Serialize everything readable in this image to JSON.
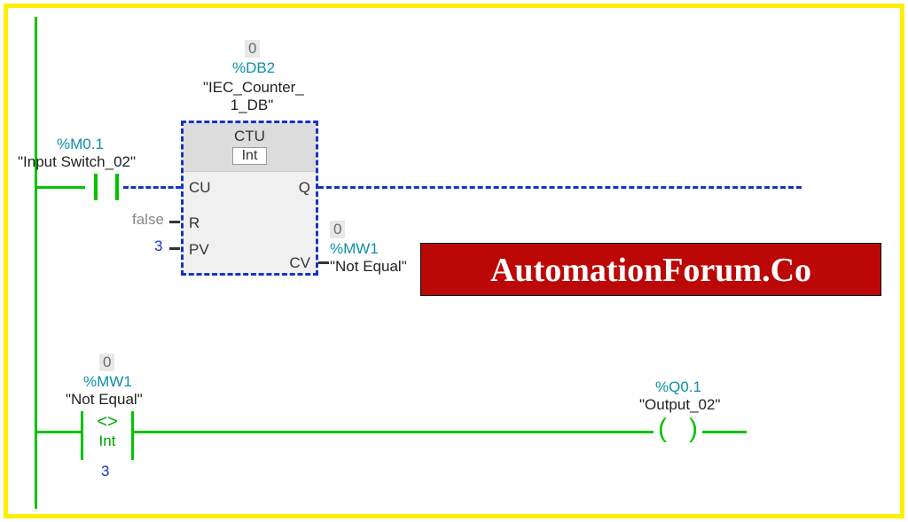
{
  "rung1": {
    "input": {
      "address": "%M0.1",
      "name": "\"Input Switch_02\""
    },
    "block": {
      "value_top": "0",
      "address": "%DB2",
      "name1": "\"IEC_Counter_",
      "name2": "1_DB\"",
      "title": "CTU",
      "subtype": "Int",
      "ports": {
        "cu": "CU",
        "r": "R",
        "pv": "PV",
        "q": "Q",
        "cv": "CV"
      },
      "r_val": "false",
      "pv_val": "3",
      "cv": {
        "value_top": "0",
        "address": "%MW1",
        "name": "\"Not Equal\""
      }
    }
  },
  "rung2": {
    "compare": {
      "value_top": "0",
      "address": "%MW1",
      "name": "\"Not Equal\"",
      "op": "<>",
      "type": "Int",
      "operand": "3"
    },
    "output": {
      "address": "%Q0.1",
      "name": "\"Output_02\""
    }
  },
  "watermark": "AutomationForum.Co"
}
